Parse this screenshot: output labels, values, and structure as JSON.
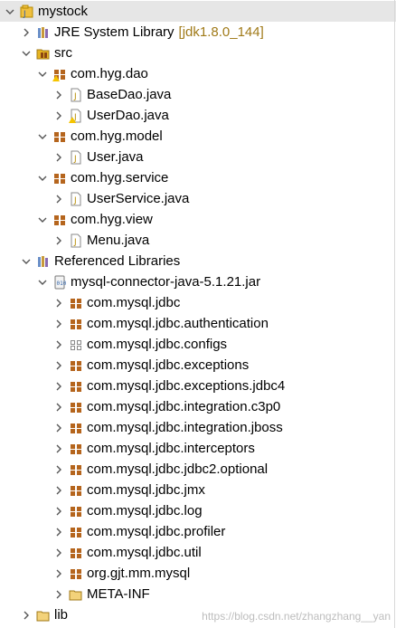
{
  "tree": {
    "project": {
      "label": "mystock"
    },
    "jre": {
      "label": "JRE System Library",
      "decoration": "[jdk1.8.0_144]"
    },
    "src": {
      "label": "src"
    },
    "pkg_dao": {
      "label": "com.hyg.dao"
    },
    "file_basedao": {
      "label": "BaseDao.java"
    },
    "file_userdao": {
      "label": "UserDao.java"
    },
    "pkg_model": {
      "label": "com.hyg.model"
    },
    "file_user": {
      "label": "User.java"
    },
    "pkg_service": {
      "label": "com.hyg.service"
    },
    "file_userservice": {
      "label": "UserService.java"
    },
    "pkg_view": {
      "label": "com.hyg.view"
    },
    "file_menu": {
      "label": "Menu.java"
    },
    "reflibs": {
      "label": "Referenced Libraries"
    },
    "jar": {
      "label": "mysql-connector-java-5.1.21.jar"
    },
    "jar_pkgs": [
      "com.mysql.jdbc",
      "com.mysql.jdbc.authentication",
      "com.mysql.jdbc.configs",
      "com.mysql.jdbc.exceptions",
      "com.mysql.jdbc.exceptions.jdbc4",
      "com.mysql.jdbc.integration.c3p0",
      "com.mysql.jdbc.integration.jboss",
      "com.mysql.jdbc.interceptors",
      "com.mysql.jdbc.jdbc2.optional",
      "com.mysql.jdbc.jmx",
      "com.mysql.jdbc.log",
      "com.mysql.jdbc.profiler",
      "com.mysql.jdbc.util",
      "org.gjt.mm.mysql",
      "META-INF"
    ],
    "lib": {
      "label": "lib"
    }
  },
  "watermark": "https://blog.csdn.net/zhangzhang__yan",
  "colors": {
    "package_brown": "#8b4513",
    "java_file": "#b58a00",
    "folder": "#e6b422",
    "selection": "#e6e6e6"
  }
}
